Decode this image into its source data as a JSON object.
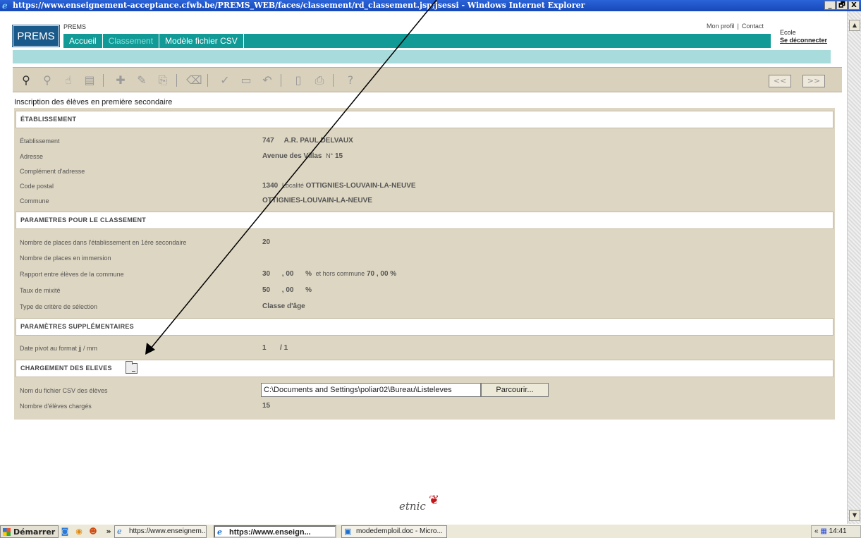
{
  "window": {
    "title": "https://www.enseignement-acceptance.cfwb.be/PREMS_WEB/faces/classement/rd_classement.jsp;jsessi - Windows Internet Explorer",
    "minimize": "_",
    "maximize": "🗗",
    "close": "X"
  },
  "app": {
    "logo": "PREMS",
    "subtitle": "PREMS",
    "tabs": [
      "Accueil",
      "Classement",
      "Modèle fichier CSV"
    ],
    "active_tab": "Classement",
    "top_links": [
      "Mon profil",
      "|",
      "Contact"
    ],
    "user_role": "Ecole",
    "logout": "Se déconnecter"
  },
  "toolbar": {
    "icons": [
      "binoculars-icon",
      "magnifier-icon",
      "hand-icon",
      "document-icon",
      "add-icon",
      "pencil-icon",
      "copy-icon",
      "trash-icon",
      "check-icon",
      "save-icon",
      "undo-icon",
      "new-doc-icon",
      "print-icon",
      "help-icon"
    ],
    "prev": "<<",
    "next": ">>"
  },
  "page_title": "Inscription des élèves en première secondaire",
  "sections": {
    "etablissement": "ÉTABLISSEMENT",
    "parametres": "PARAMETRES POUR LE CLASSEMENT",
    "supplementaires": "PARAMÈTRES SUPPLÉMENTAIRES",
    "chargement": "CHARGEMENT DES ELEVES"
  },
  "etablissement": {
    "labels": {
      "etablissement": "Établissement",
      "adresse": "Adresse",
      "complement": "Complément d'adresse",
      "code_postal": "Code postal",
      "commune": "Commune"
    },
    "numero": "747",
    "nom": "A.R. PAUL DELVAUX",
    "rue": "Avenue des Villas",
    "numero_rue_label": "N°",
    "numero_rue": "15",
    "code_postal": "1340",
    "localite_label": "Localité",
    "localite": "OTTIGNIES-LOUVAIN-LA-NEUVE",
    "commune": "OTTIGNIES-LOUVAIN-LA-NEUVE"
  },
  "parametres": {
    "labels": {
      "places": "Nombre de places dans l'établissement en 1ère secondaire",
      "immersion": "Nombre de places en immersion",
      "rapport": "Rapport entre élèves de la commune",
      "mixite": "Taux de mixité",
      "critere": "Type de critère de sélection"
    },
    "places": "20",
    "rapport_int": "30",
    "rapport_dec": ", 00",
    "percent": "%",
    "hors_label": "et hors commune",
    "hors_value": "70 , 00 %",
    "mixite_int": "50",
    "mixite_dec": ", 00",
    "critere": "Classe d'âge"
  },
  "supplementaires": {
    "label": "Date pivot au format jj / mm",
    "jour": "1",
    "mois": "/ 1"
  },
  "chargement": {
    "file_label": "Nom du fichier CSV des élèves",
    "file_value": "C:\\Documents and Settings\\poliar02\\Bureau\\Listeleves",
    "browse": "Parcourir...",
    "count_label": "Nombre d'élèves chargés",
    "count": "15"
  },
  "footer": {
    "brand": "etnic"
  },
  "taskbar": {
    "start": "Démarrer",
    "chevron": "»",
    "tasks": [
      "https://www.enseignem...",
      "https://www.enseign...",
      "modedemploil.doc - Micro..."
    ],
    "tray_chevron": "«",
    "clock": "14:41"
  }
}
